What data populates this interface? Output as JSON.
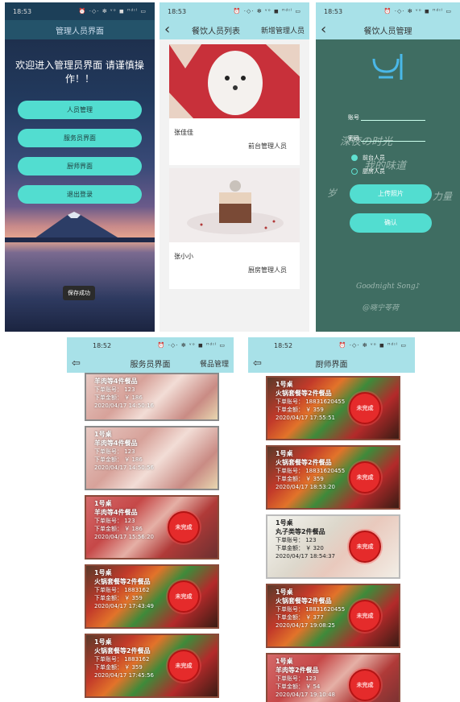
{
  "screen_admin": {
    "time": "18:53",
    "status_icons": "⏰ ·◇· ✻ ᵛᵒ ◼ ᴴᵈᶦˡ ▭",
    "title": "管理人员界面",
    "welcome": "欢迎进入管理员界面 请谨慎操作！！",
    "buttons": [
      "人员管理",
      "服务员界面",
      "厨师界面",
      "退出登录"
    ],
    "toast": "保存成功"
  },
  "screen_staff_list": {
    "time": "18:53",
    "status_icons": "⏰ ·◇· ✻ ᵛᵒ ◼ ᴴᵈᶦˡ ▭",
    "title": "餐饮人员列表",
    "right_action": "新增管理人员",
    "staff": [
      {
        "name": "张佳佳",
        "role": "前台管理人员"
      },
      {
        "name": "张小小",
        "role": "厨房管理人员"
      }
    ]
  },
  "screen_staff_manage": {
    "time": "18:53",
    "status_icons": "⏰ ·◇· ✻ ᵛᵒ ◼ ᴴᵈᶦˡ ▭",
    "title": "餐饮人员管理",
    "account_label": "账号",
    "password_label": "密码",
    "radio_options": [
      "前台人员",
      "厨房人员"
    ],
    "upload_button": "上传照片",
    "confirm_button": "确认",
    "chalk_texts": [
      "深夜の时光",
      "我的味道",
      "岁",
      "力量",
      "Goodnight Song♪",
      "@晓宁苓荷"
    ]
  },
  "screen_waiter": {
    "time": "18:52",
    "status_icons": "⏰ ·◇· ✻ ᵛᵒ ◼ ᴴᵈᶦˡ ▭",
    "title": "服务员界面",
    "right_action": "餐品管理",
    "orders": [
      {
        "table": "",
        "items": "羊肉等4件餐品",
        "order_no": "下单账号：   123",
        "amount": "下单金额：  ￥ 186",
        "time": "2020/04/17 14:50:16",
        "stamp": ""
      },
      {
        "table": "1号桌",
        "items": "羊肉等4件餐品",
        "order_no": "下单账号：   123",
        "amount": "下单金额：  ￥ 186",
        "time": "2020/04/17 14:50:56",
        "stamp": ""
      },
      {
        "table": "1号桌",
        "items": "羊肉等4件餐品",
        "order_no": "下单账号：   123",
        "amount": "下单金额：  ￥ 186",
        "time": "2020/04/17 15:56:20",
        "stamp": "未完成"
      },
      {
        "table": "1号桌",
        "items": "火锅套餐等2件餐品",
        "order_no": "下单账号：   1883162",
        "amount": "下单金额：  ￥ 359",
        "time": "2020/04/17 17:43:49",
        "stamp": "未完成"
      },
      {
        "table": "1号桌",
        "items": "火锅套餐等2件餐品",
        "order_no": "下单账号：   1883162",
        "amount": "下单金额：  ￥ 359",
        "time": "2020/04/17 17:45:56",
        "stamp": "未完成"
      }
    ]
  },
  "screen_chef": {
    "time": "18:52",
    "status_icons": "⏰ ·◇· ✻ ᵛᵒ ◼ ᴴᵈᶦˡ ▭",
    "title": "厨师界面",
    "orders": [
      {
        "table": "1号桌",
        "items": "火锅套餐等2件餐品",
        "order_no": "下单账号：   18831620455",
        "amount": "下单金额：  ￥ 359",
        "time": "2020/04/17 17:55:51",
        "stamp": "未完成"
      },
      {
        "table": "1号桌",
        "items": "火锅套餐等2件餐品",
        "order_no": "下单账号：   18831620455",
        "amount": "下单金额：  ￥ 359",
        "time": "2020/04/17 18:53:20",
        "stamp": "未完成"
      },
      {
        "table": "1号桌",
        "items": "丸子类等2件餐品",
        "order_no": "下单账号：   123",
        "amount": "下单金额：  ￥ 320",
        "time": "2020/04/17 18:54:37",
        "stamp": "未完成"
      },
      {
        "table": "1号桌",
        "items": "火锅套餐等2件餐品",
        "order_no": "下单账号：   18831620455",
        "amount": "下单金额：  ￥ 377",
        "time": "2020/04/17 19:08:25",
        "stamp": "未完成"
      },
      {
        "table": "1号桌",
        "items": "羊肉等2件餐品",
        "order_no": "下单账号：   123",
        "amount": "下单金额：  ￥ 54",
        "time": "2020/04/17 19:10:48",
        "stamp": "未完成"
      }
    ]
  },
  "colors": {
    "appbar": "#a8e1e8",
    "pill": "#52ddd0",
    "stamp": "#e52b2b",
    "chalkboard": "#3f6d62"
  }
}
